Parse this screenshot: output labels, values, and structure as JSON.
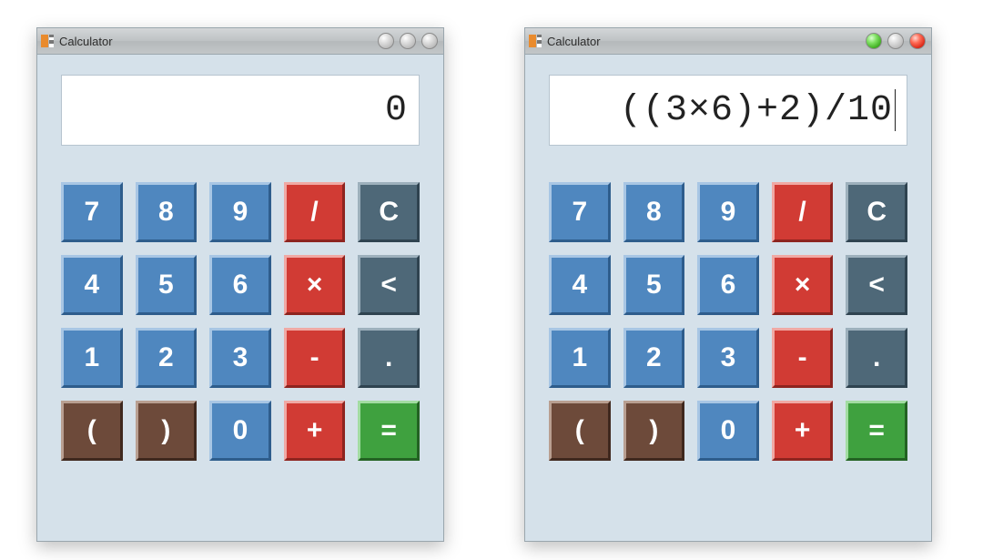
{
  "calculators": [
    {
      "title": "Calculator",
      "display": "0",
      "caret": false,
      "window_buttons": [
        "plain",
        "plain",
        "plain"
      ]
    },
    {
      "title": "Calculator",
      "display": "((3×6)+2)/10",
      "caret": true,
      "window_buttons": [
        "green",
        "plain",
        "red"
      ]
    }
  ],
  "keys": [
    [
      {
        "label": "7",
        "kind": "num",
        "name": "key-7"
      },
      {
        "label": "8",
        "kind": "num",
        "name": "key-8"
      },
      {
        "label": "9",
        "kind": "num",
        "name": "key-9"
      },
      {
        "label": "/",
        "kind": "op",
        "name": "key-divide"
      },
      {
        "label": "C",
        "kind": "slate",
        "name": "key-clear"
      }
    ],
    [
      {
        "label": "4",
        "kind": "num",
        "name": "key-4"
      },
      {
        "label": "5",
        "kind": "num",
        "name": "key-5"
      },
      {
        "label": "6",
        "kind": "num",
        "name": "key-6"
      },
      {
        "label": "×",
        "kind": "op",
        "name": "key-multiply"
      },
      {
        "label": "<",
        "kind": "slate",
        "name": "key-backspace"
      }
    ],
    [
      {
        "label": "1",
        "kind": "num",
        "name": "key-1"
      },
      {
        "label": "2",
        "kind": "num",
        "name": "key-2"
      },
      {
        "label": "3",
        "kind": "num",
        "name": "key-3"
      },
      {
        "label": "-",
        "kind": "op",
        "name": "key-minus"
      },
      {
        "label": ".",
        "kind": "slate",
        "name": "key-decimal"
      }
    ],
    [
      {
        "label": "(",
        "kind": "brown",
        "name": "key-open-paren"
      },
      {
        "label": ")",
        "kind": "brown",
        "name": "key-close-paren"
      },
      {
        "label": "0",
        "kind": "num",
        "name": "key-0"
      },
      {
        "label": "+",
        "kind": "op",
        "name": "key-plus"
      },
      {
        "label": "=",
        "kind": "green",
        "name": "key-equals"
      }
    ]
  ]
}
